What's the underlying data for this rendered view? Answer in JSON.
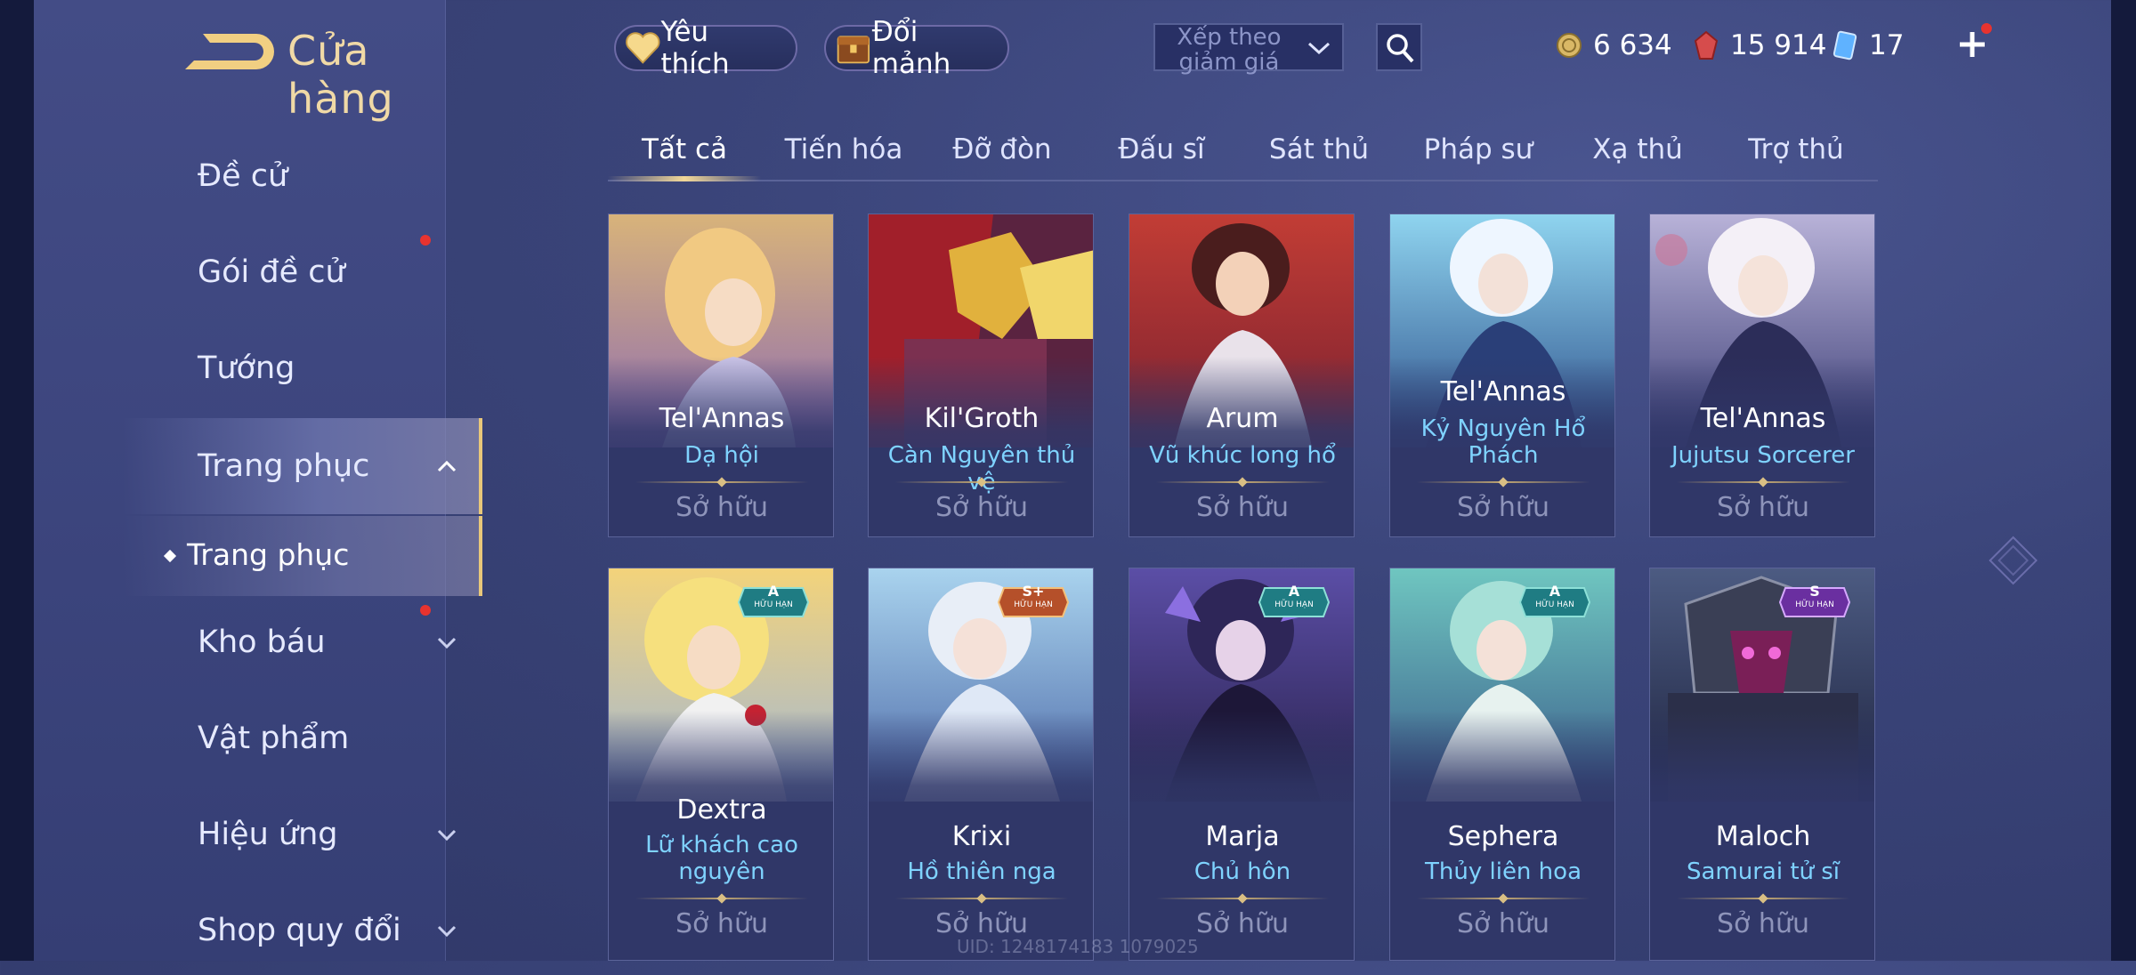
{
  "header": {
    "title": "Cửa hàng",
    "favorites_label": "Yêu thích",
    "exchange_label": "Đổi mảnh",
    "sort_label": "Xếp theo giảm giá",
    "currencies": [
      {
        "name": "gold-coin",
        "value": "6 634"
      },
      {
        "name": "ruby-voucher",
        "value": "15 914"
      },
      {
        "name": "shard",
        "value": "17"
      }
    ]
  },
  "sidebar": {
    "items": [
      {
        "label": "Đề cử"
      },
      {
        "label": "Gói đề cử"
      },
      {
        "label": "Tướng"
      },
      {
        "label": "Trang phục"
      },
      {
        "label": "Kho báu"
      },
      {
        "label": "Vật phẩm"
      },
      {
        "label": "Hiệu ứng"
      },
      {
        "label": "Shop quy đổi"
      }
    ],
    "sub_item": "Trang phục"
  },
  "tabs": [
    "Tất cả",
    "Tiến hóa",
    "Đỡ đòn",
    "Đấu sĩ",
    "Sát thủ",
    "Pháp sư",
    "Xạ thủ",
    "Trợ thủ"
  ],
  "cards": [
    {
      "hero": "Tel'Annas",
      "skin": "Dạ hội",
      "status": "Sở hữu",
      "badge": ""
    },
    {
      "hero": "Kil'Groth",
      "skin": "Càn Nguyên thủ vệ",
      "status": "Sở hữu",
      "badge": ""
    },
    {
      "hero": "Arum",
      "skin": "Vũ khúc long hổ",
      "status": "Sở hữu",
      "badge": ""
    },
    {
      "hero": "Tel'Annas",
      "skin": "Kỷ Nguyên Hổ Phách",
      "status": "Sở hữu",
      "badge": ""
    },
    {
      "hero": "Tel'Annas",
      "skin": "Jujutsu Sorcerer",
      "status": "Sở hữu",
      "badge": ""
    },
    {
      "hero": "Dextra",
      "skin": "Lữ khách cao nguyên",
      "status": "Sở hữu",
      "badge": "A",
      "badge_sub": "HỮU HẠN"
    },
    {
      "hero": "Krixi",
      "skin": "Hồ thiên nga",
      "status": "Sở hữu",
      "badge": "S+",
      "badge_sub": "HỮU HẠN"
    },
    {
      "hero": "Marja",
      "skin": "Chủ hôn",
      "status": "Sở hữu",
      "badge": "A",
      "badge_sub": "HỮU HẠN"
    },
    {
      "hero": "Sephera",
      "skin": "Thủy liên hoa",
      "status": "Sở hữu",
      "badge": "A",
      "badge_sub": "HỮU HẠN"
    },
    {
      "hero": "Maloch",
      "skin": "Samurai tử sĩ",
      "status": "Sở hữu",
      "badge": "S",
      "badge_sub": "HỮU HẠN"
    }
  ],
  "uid": "UID: 1248174183 1079025",
  "colors": {
    "accent_gold": "#e8c77a",
    "skin_name_blue": "#7fd3ff",
    "notification_red": "#e8332f"
  }
}
